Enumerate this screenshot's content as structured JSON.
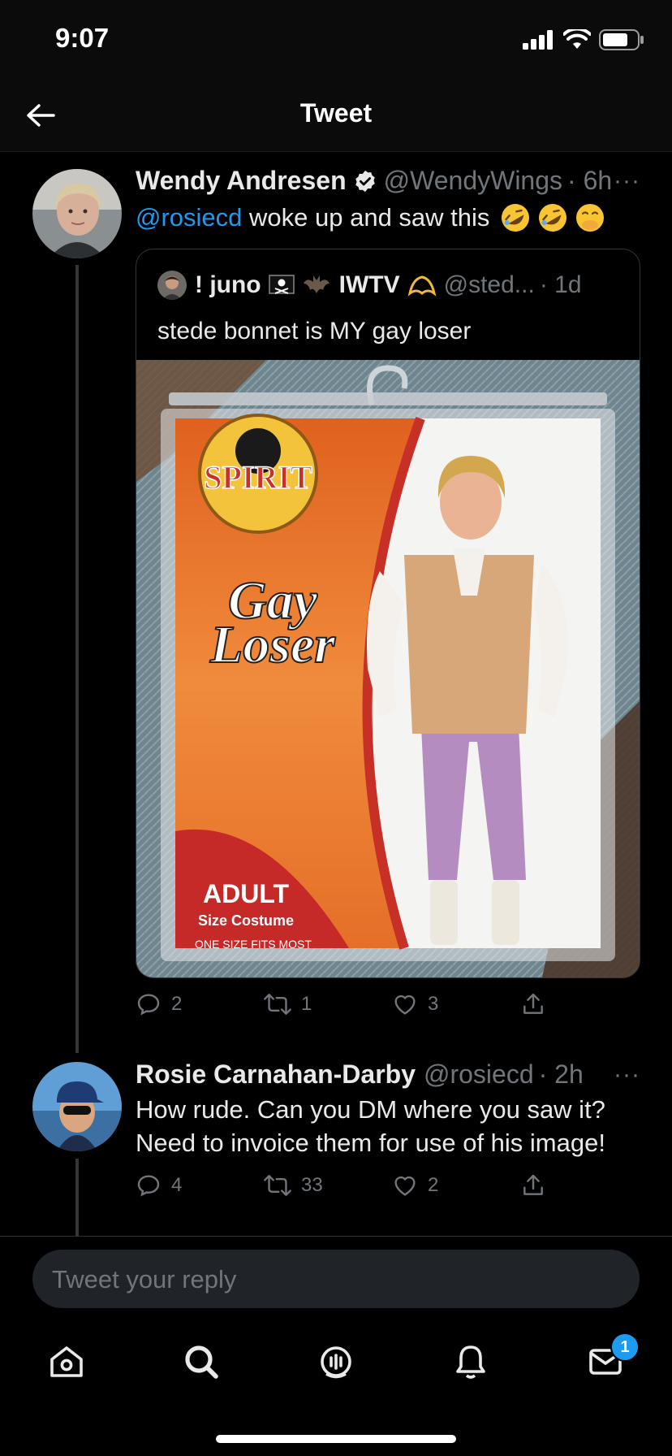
{
  "status_bar": {
    "time": "9:07"
  },
  "header": {
    "title": "Tweet"
  },
  "main_tweet": {
    "author_name": "Wendy Andresen",
    "handle": "@WendyWings",
    "time": "· 6h",
    "more": "···",
    "mention": "@rosiecd",
    "text": " woke up and saw this",
    "emojis": [
      "rolling-on-floor-laughing",
      "rolling-on-floor-laughing",
      "face-with-hand-over-mouth"
    ],
    "quote": {
      "author": "! juno",
      "author_suffix": "IWTV",
      "handle": "@sted...",
      "time": "· 1d",
      "text": "stede bonnet is MY gay loser",
      "image": {
        "brand": "SPIRIT",
        "title_line1": "Gay",
        "title_line2": "Loser",
        "size_label": "ADULT",
        "size_sub": "Size Costume",
        "fit": "ONE SIZE FITS MOST"
      }
    },
    "actions": {
      "replies": "2",
      "retweets": "1",
      "likes": "3"
    }
  },
  "reply_tweet": {
    "author_name": "Rosie Carnahan-Darby",
    "handle": "@rosiecd",
    "time": "· 2h",
    "more": "···",
    "line1": "How rude. Can you DM where you saw it?",
    "line2": "Need to invoice them for use of his image!",
    "actions": {
      "replies": "4",
      "retweets": "33",
      "likes": "2"
    }
  },
  "composer": {
    "placeholder": "Tweet your reply"
  },
  "tab_bar": {
    "items": [
      "home-icon",
      "search-icon",
      "spaces-icon",
      "notifications-icon",
      "messages-icon"
    ],
    "messages_badge": "1"
  },
  "colors": {
    "accent": "#1d9bf0",
    "background": "#000000",
    "muted": "#71767b"
  }
}
